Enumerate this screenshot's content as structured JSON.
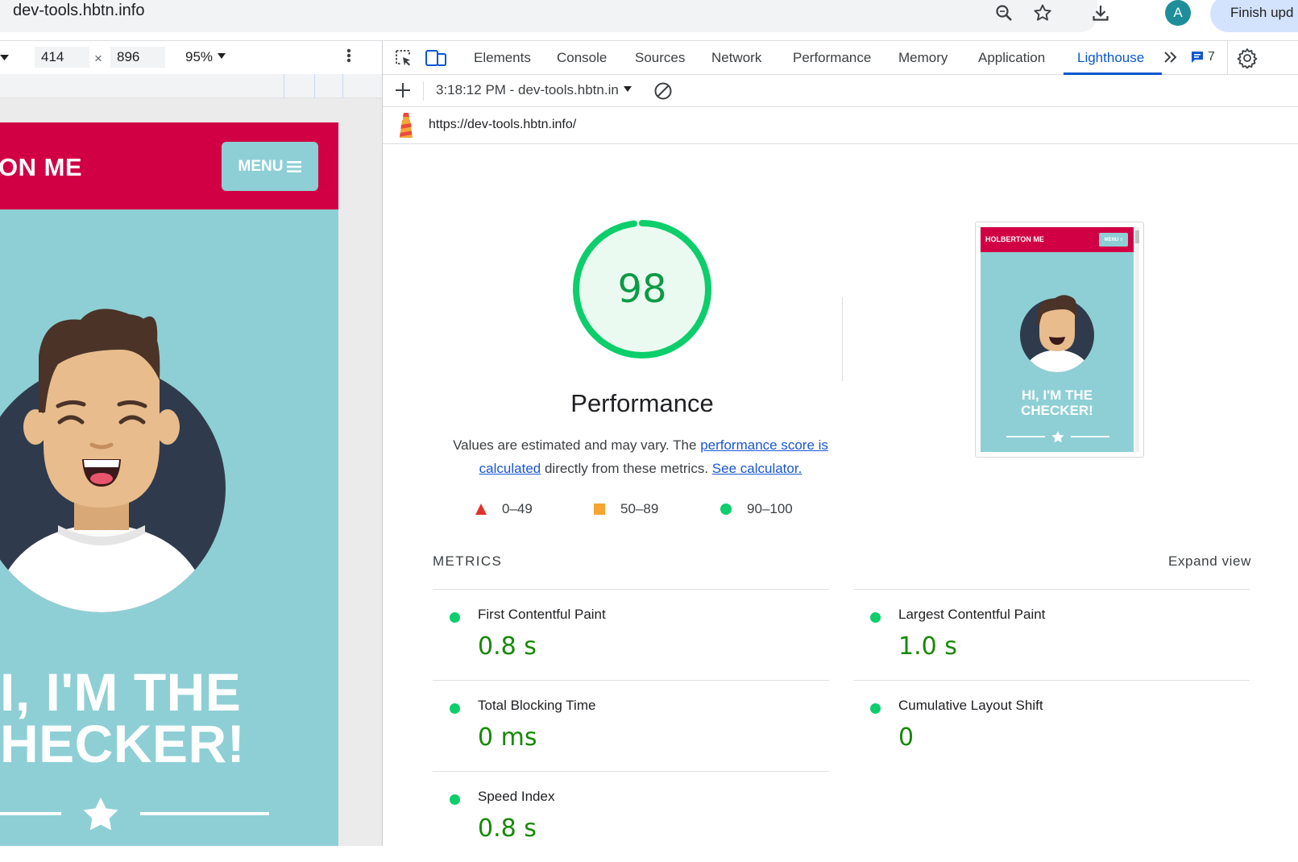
{
  "browser": {
    "address": "dev-tools.hbtn.info",
    "avatar_letter": "A",
    "update_button": "Finish upd"
  },
  "device_toolbar": {
    "width": "414",
    "height": "896",
    "times": "×",
    "zoom": "95%"
  },
  "mobile_page": {
    "brand": "ON ME",
    "menu": "MENU",
    "hero_line1": "I, I'M THE",
    "hero_line2": "HECKER!"
  },
  "devtools": {
    "tabs": [
      "Elements",
      "Console",
      "Sources",
      "Network",
      "Performance",
      "Memory",
      "Application",
      "Lighthouse"
    ],
    "active_tab": "Lighthouse",
    "issues_count": "7",
    "report_select": "3:18:12 PM - dev-tools.hbtn.in",
    "report_url": "https://dev-tools.hbtn.info/"
  },
  "report": {
    "score": "98",
    "score_fraction": 0.98,
    "category": "Performance",
    "desc_part1": "Values are estimated and may vary. The ",
    "desc_link1": "performance score is calculated",
    "desc_part2": " directly from these metrics. ",
    "desc_link2": "See calculator.",
    "legend": [
      {
        "range": "0–49",
        "shape": "triangle",
        "color": "#e0332d"
      },
      {
        "range": "50–89",
        "shape": "square",
        "color": "#f6a531"
      },
      {
        "range": "90–100",
        "shape": "circle",
        "color": "#0cce6b"
      }
    ],
    "screenshot": {
      "brand": "HOLBERTON ME",
      "menu": "MENU ≡",
      "title_line1": "HI, I'M THE",
      "title_line2": "CHECKER!"
    },
    "metrics_title": "METRICS",
    "expand_view": "Expand view",
    "metrics": [
      {
        "label": "First Contentful Paint",
        "value": "0.8 s"
      },
      {
        "label": "Largest Contentful Paint",
        "value": "1.0 s"
      },
      {
        "label": "Total Blocking Time",
        "value": "0 ms"
      },
      {
        "label": "Cumulative Layout Shift",
        "value": "0"
      },
      {
        "label": "Speed Index",
        "value": "0.8 s"
      }
    ],
    "colors": {
      "pass": "#0cce6b",
      "pass_text": "#168a04",
      "link": "#1a55d6",
      "accent": "#0b57d0"
    }
  }
}
